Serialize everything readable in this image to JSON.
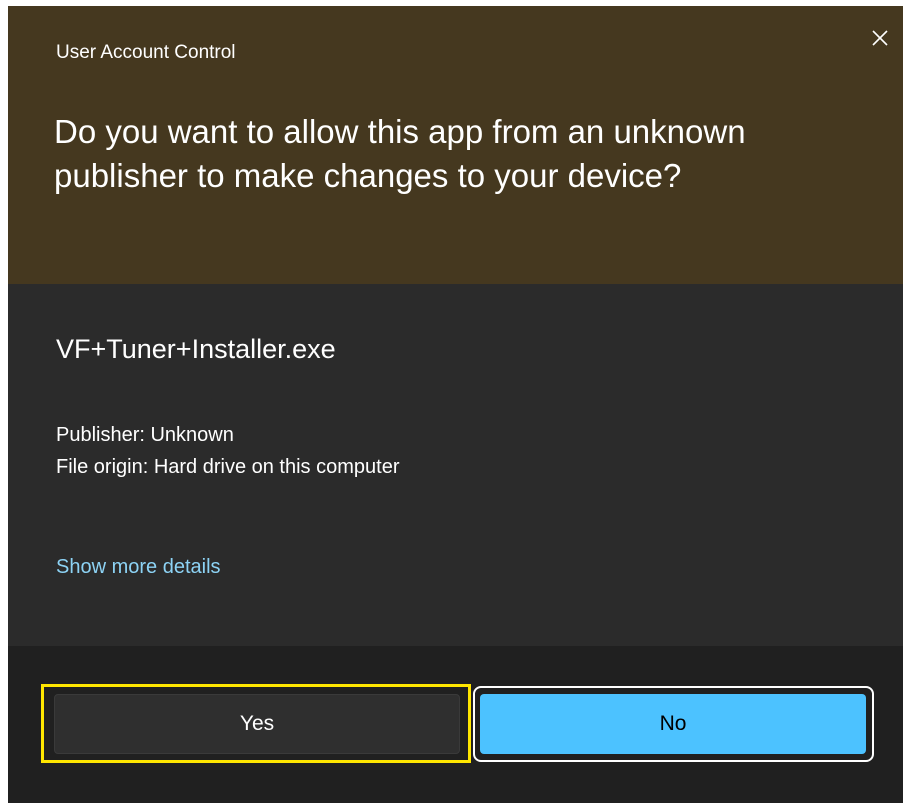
{
  "dialog": {
    "title": "User Account Control",
    "close_icon": "close-icon",
    "question": "Do you want to allow this app from an unknown publisher to make changes to your device?",
    "program_name": "VF+Tuner+Installer.exe",
    "publisher": "Publisher: Unknown",
    "file_origin": "File origin: Hard drive on this computer",
    "show_details": "Show more details",
    "buttons": {
      "yes": "Yes",
      "no": "No"
    },
    "colors": {
      "header_bg": "#45381f",
      "body_bg": "#2b2b2b",
      "footer_bg": "#202020",
      "link": "#8dd3f5",
      "primary_button": "#4cc2ff",
      "highlight": "#ffe600"
    }
  }
}
